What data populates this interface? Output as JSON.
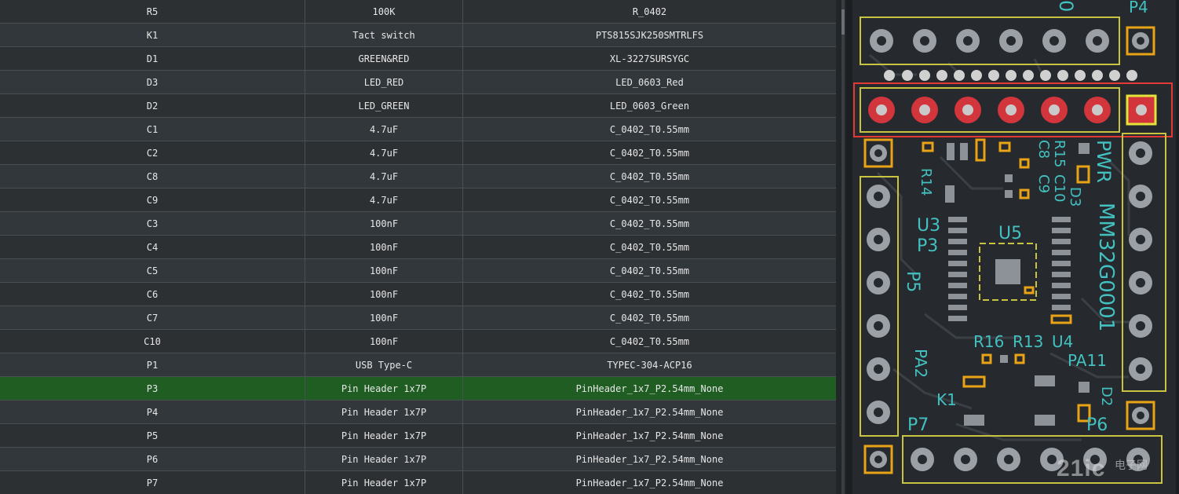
{
  "bom_rows": [
    {
      "designator": "R5",
      "value": "100K",
      "footprint": "R_0402"
    },
    {
      "designator": "K1",
      "value": "Tact switch",
      "footprint": "PTS815SJK250SMTRLFS"
    },
    {
      "designator": "D1",
      "value": "GREEN&RED",
      "footprint": "XL-3227SURSYGC"
    },
    {
      "designator": "D3",
      "value": "LED_RED",
      "footprint": "LED_0603_Red"
    },
    {
      "designator": "D2",
      "value": "LED_GREEN",
      "footprint": "LED_0603_Green"
    },
    {
      "designator": "C1",
      "value": "4.7uF",
      "footprint": "C_0402_T0.55mm"
    },
    {
      "designator": "C2",
      "value": "4.7uF",
      "footprint": "C_0402_T0.55mm"
    },
    {
      "designator": "C8",
      "value": "4.7uF",
      "footprint": "C_0402_T0.55mm"
    },
    {
      "designator": "C9",
      "value": "4.7uF",
      "footprint": "C_0402_T0.55mm"
    },
    {
      "designator": "C3",
      "value": "100nF",
      "footprint": "C_0402_T0.55mm"
    },
    {
      "designator": "C4",
      "value": "100nF",
      "footprint": "C_0402_T0.55mm"
    },
    {
      "designator": "C5",
      "value": "100nF",
      "footprint": "C_0402_T0.55mm"
    },
    {
      "designator": "C6",
      "value": "100nF",
      "footprint": "C_0402_T0.55mm"
    },
    {
      "designator": "C7",
      "value": "100nF",
      "footprint": "C_0402_T0.55mm"
    },
    {
      "designator": "C10",
      "value": "100nF",
      "footprint": "C_0402_T0.55mm"
    },
    {
      "designator": "P1",
      "value": "USB Type-C",
      "footprint": "TYPEC-304-ACP16"
    },
    {
      "designator": "P3",
      "value": "Pin Header 1x7P",
      "footprint": "PinHeader_1x7_P2.54mm_None",
      "selected": true
    },
    {
      "designator": "P4",
      "value": "Pin Header 1x7P",
      "footprint": "PinHeader_1x7_P2.54mm_None"
    },
    {
      "designator": "P5",
      "value": "Pin Header 1x7P",
      "footprint": "PinHeader_1x7_P2.54mm_None"
    },
    {
      "designator": "P6",
      "value": "Pin Header 1x7P",
      "footprint": "PinHeader_1x7_P2.54mm_None"
    },
    {
      "designator": "P7",
      "value": "Pin Header 1x7P",
      "footprint": "PinHeader_1x7_P2.54mm_None"
    }
  ],
  "pcb": {
    "labels": {
      "p4": "P4",
      "pwr": "PWR",
      "mcu": "MM32G0001",
      "u3": "U3",
      "u5": "U5",
      "u4": "U4",
      "p3": "P3",
      "p5": "P5",
      "r14": "R14",
      "r15": "R15",
      "c8": "C8",
      "c9": "C9",
      "c10": "C10",
      "d3": "D3",
      "r16": "R16",
      "r13": "R13",
      "pa2": "PA2",
      "pa11": "PA11",
      "k1": "K1",
      "d2": "D2",
      "p6": "P6",
      "p7": "P7",
      "top_digits": "0"
    },
    "colors": {
      "board": "#262a2e",
      "pad": "#9aa0a5",
      "highlight_pad": "#d2363c",
      "copper_outline": "#e8a317",
      "silk": "#43c0c0",
      "outline": "#c8c341",
      "selection": "#e53935"
    }
  },
  "watermark": {
    "main": "21ic",
    "sub": "电子网"
  }
}
